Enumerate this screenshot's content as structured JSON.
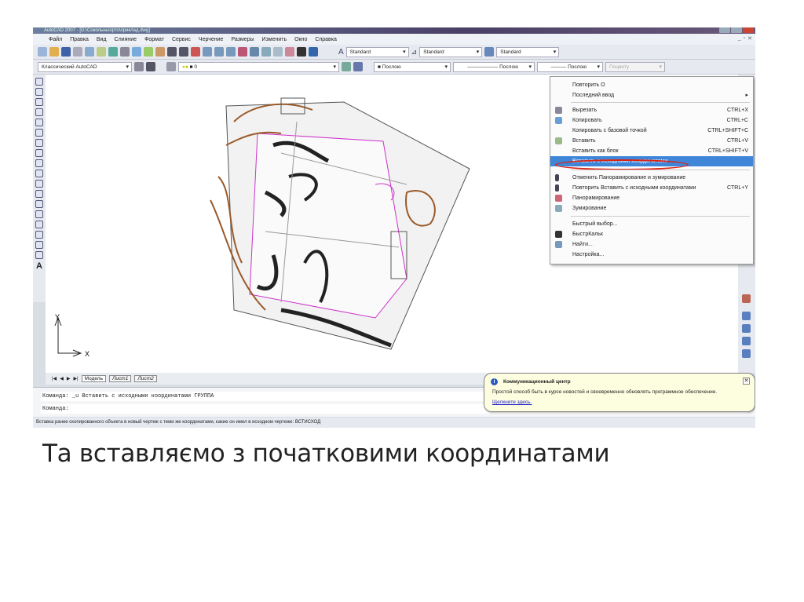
{
  "window": {
    "title": "AutoCAD 2007 - [G:\\Сокольнь\\орто\\приклад.dwg]"
  },
  "menu": [
    "Файл",
    "Правка",
    "Вид",
    "Слияние",
    "Формат",
    "Сервис",
    "Черчение",
    "Размеры",
    "Изменить",
    "Окно",
    "Справка"
  ],
  "toolbar": {
    "text_style": "Standard",
    "dim_style": "Standard",
    "table_style": "Standard",
    "workspace": "Классический AutoCAD",
    "layer": "0",
    "color": "Послою",
    "linetype": "Послою",
    "lineweight": "Послою",
    "plotstyle": "Поцвету"
  },
  "axes": {
    "y": "Y",
    "x": "X"
  },
  "tabs": {
    "model": "Модель",
    "sheet1": "Лист1",
    "sheet2": "Лист2"
  },
  "context_menu": {
    "items": [
      {
        "label": "Повторить О",
        "shortcut": ""
      },
      {
        "label": "Последний ввод",
        "shortcut": "▸"
      },
      {
        "label": "Вырезать",
        "shortcut": "CTRL+X"
      },
      {
        "label": "Копировать",
        "shortcut": "CTRL+C"
      },
      {
        "label": "Копировать с базовой точкой",
        "shortcut": "CTRL+SHIFT+C"
      },
      {
        "label": "Вставить",
        "shortcut": "CTRL+V"
      },
      {
        "label": "Вставить как блок",
        "shortcut": "CTRL+SHIFT+V"
      },
      {
        "label": "Вставить с исходными координатами",
        "shortcut": ""
      },
      {
        "label": "Отменить Панорамирование и зумирование",
        "shortcut": ""
      },
      {
        "label": "Повторить Вставить с исходными координатами",
        "shortcut": "CTRL+Y"
      },
      {
        "label": "Панорамирование",
        "shortcut": ""
      },
      {
        "label": "Зумирование",
        "shortcut": ""
      },
      {
        "label": "Быстрый выбор...",
        "shortcut": ""
      },
      {
        "label": "БыстрКальк",
        "shortcut": ""
      },
      {
        "label": "Найти...",
        "shortcut": ""
      },
      {
        "label": "Настройка...",
        "shortcut": ""
      }
    ]
  },
  "command": {
    "line1": "Команда: _u Вставить с исходными координатами ГРУППА",
    "line2": "Команда:"
  },
  "status": "Вставка ранее скопированного объекта в новый чертеж с теми же координатами, какие он имел в исходном чертеже:  ВСТИСХОД",
  "balloon": {
    "title": "Коммуникационный центр",
    "text": "Простой способ быть в курсе новостей и своевременно обновлять программное обеспечение.",
    "link": "Щелкните здесь."
  },
  "caption": "Та вставляємо з початковими координатами"
}
